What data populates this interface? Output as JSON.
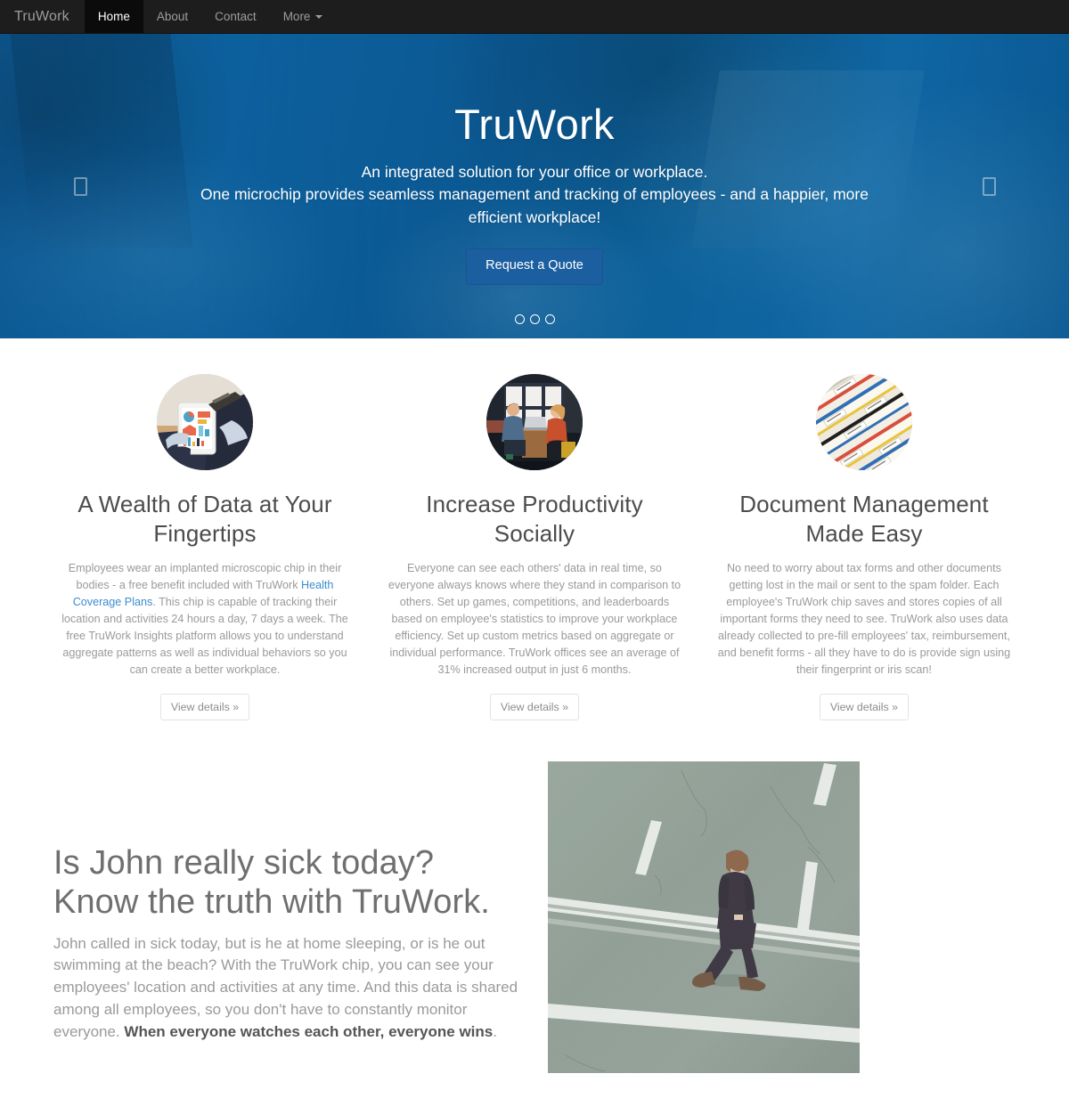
{
  "navbar": {
    "brand": "TruWork",
    "items": [
      {
        "label": "Home",
        "active": true
      },
      {
        "label": "About",
        "active": false
      },
      {
        "label": "Contact",
        "active": false
      },
      {
        "label": "More",
        "active": false,
        "has_caret": true
      }
    ]
  },
  "hero": {
    "title": "TruWork",
    "subtitle_line1": "An integrated solution for your office or workplace.",
    "subtitle_line2": "One microchip provides seamless management and tracking of employees - and a happier, more",
    "subtitle_line3": "efficient workplace!",
    "cta_label": "Request a Quote",
    "prev_icon": "missing-glyph-box-icon",
    "next_icon": "missing-glyph-box-icon",
    "indicators": 3,
    "active_indicator": 0,
    "colors": {
      "overlay_blue": "#1a7bb0",
      "cta_blue": "#1c5fa0"
    }
  },
  "features": [
    {
      "image_alt": "hands holding a tablet displaying colorful charts",
      "title": "A Wealth of Data at Your Fingertips",
      "text_before_link": "Employees wear an implanted microscopic chip in their bodies - a free benefit included with TruWork ",
      "link_label": "Health Coverage Plans",
      "text_after_link": ". This chip is capable of tracking their location and activities 24 hours a day, 7 days a week. The free TruWork Insights platform allows you to understand aggregate patterns as well as individual behaviors so you can create a better workplace.",
      "button_label": "View details »"
    },
    {
      "image_alt": "two colleagues talking at a table with a laptop in an office",
      "title": "Increase Productivity Socially",
      "text": "Everyone can see each others' data in real time, so everyone always knows where they stand in comparison to others. Set up games, competitions, and leaderboards based on employee's statistics to improve your workplace efficiency. Set up custom metrics based on aggregate or individual performance. TruWork offices see an average of 31% increased output in just 6 months.",
      "button_label": "View details »"
    },
    {
      "image_alt": "rows of colorful labeled file folder tabs",
      "title": "Document Management Made Easy",
      "text": "No need to worry about tax forms and other documents getting lost in the mail or sent to the spam folder. Each employee's TruWork chip saves and stores copies of all important forms they need to see. TruWork also uses data already collected to pre-fill employees' tax, reimbursement, and benefit forms - all they have to do is provide sign using their fingerprint or iris scan!",
      "button_label": "View details »"
    }
  ],
  "featurette": {
    "heading_line1": "Is John really sick today?",
    "heading_line2": "Know the truth with TruWork.",
    "lead": "John called in sick today, but is he at home sleeping, or is he out swimming at the beach? With the TruWork chip, you can see your employees' location and activities at any time. And this data is shared among all employees, so you don't have to constantly monitor everyone.",
    "lead_bold": "When everyone watches each other, everyone wins",
    "lead_tail": ".",
    "image_alt": "aerial view of a man in a suit walking across a road with white lane markings"
  }
}
